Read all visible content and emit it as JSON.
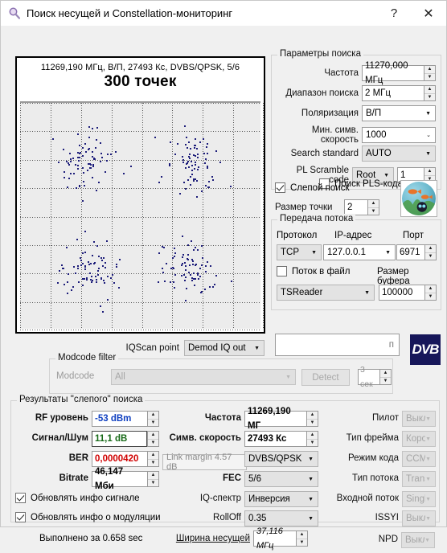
{
  "window": {
    "title": "Поиск несущей и Constellation-мониторинг",
    "icon": "magnifier-icon",
    "help_label": "?",
    "close_label": "✕"
  },
  "constellation": {
    "header_line1": "11269,190 МГц, В/П, 27493 Кс, DVBS/QPSK, 5/6",
    "header_line2": "300 точек",
    "point_color": "#1d1d7a",
    "background": "#ececec",
    "grid_divisions": 8
  },
  "search_params": {
    "legend": "Параметры поиска",
    "frequency": {
      "label": "Частота",
      "value": "11270,000 МГц"
    },
    "range": {
      "label": "Диапазон поиска",
      "value": "2 МГц"
    },
    "polarization": {
      "label": "Поляризация",
      "value": "В/П"
    },
    "min_symbol_rate": {
      "label": "Мин. симв. скорость",
      "value": "1000"
    },
    "search_standard": {
      "label": "Search standard",
      "value": "AUTO"
    },
    "pl_scramble": {
      "label": "PL Scramble code",
      "mode": "Root",
      "value": "1"
    },
    "pls_search": {
      "label": "Поиск PLS-кода",
      "checked": false
    }
  },
  "blind": {
    "blind_search": {
      "label": "Слепой поиск",
      "checked": true
    },
    "point_size": {
      "label": "Размер точки",
      "value": "2"
    },
    "aquarium_icon": "aquarium-thumbnail"
  },
  "stream": {
    "legend": "Передача потока",
    "protocol_label": "Протокол",
    "protocol_value": "TCP",
    "ip_label": "IP-адрес",
    "ip_value": "127.0.0.1",
    "port_label": "Порт",
    "port_value": "6971",
    "to_file": {
      "label": "Поток в файл",
      "checked": false
    },
    "app_value": "TSReader",
    "buffer_label": "Размер буфера",
    "buffer_value": "100000"
  },
  "iqscan": {
    "label": "IQScan point",
    "value": "Demod IQ out",
    "info_value": "п"
  },
  "modcode": {
    "legend": "Modcode filter",
    "label": "Modcode",
    "value": "All",
    "detect_label": "Detect",
    "timeout_value": "3 сек"
  },
  "dvb_logo": "DVB",
  "results": {
    "legend": "Результаты \"слепого\" поиска",
    "rf_level": {
      "label": "RF уровень",
      "value": "-53 dBm",
      "color": "#1040c0"
    },
    "snr": {
      "label": "Сигнал/Шум",
      "value": "11,1 dB",
      "color": "#186a18"
    },
    "ber": {
      "label": "BER",
      "value": "0,0000420",
      "color": "#d00000"
    },
    "bitrate": {
      "label": "Bitrate",
      "value": "46,147 Мби"
    },
    "link_margin": "Link margin 4.57 dB",
    "frequency": {
      "label": "Частота",
      "value": "11269,190 МГ"
    },
    "symbol_rate": {
      "label": "Симв. скорость",
      "value": "27493 Кс"
    },
    "modulation_value": "DVBS/QPSK",
    "fec": {
      "label": "FEC",
      "value": "5/6"
    },
    "iq_spectrum": {
      "label": "IQ-спектр",
      "value": "Инверсия"
    },
    "rolloff": {
      "label": "RollOff",
      "value": "0.35"
    },
    "carrier_width": {
      "label": "Ширина несущей",
      "value": "37,116 МГц"
    },
    "pilot": {
      "label": "Пилот",
      "value": "Выкл."
    },
    "frame_type": {
      "label": "Тип фрейма",
      "value": "Короткий"
    },
    "code_mode": {
      "label": "Режим кода",
      "value": "CCM"
    },
    "stream_type": {
      "label": "Тип потока",
      "value": "Transport"
    },
    "input_stream": {
      "label": "Входной поток",
      "value": "Single"
    },
    "issyi": {
      "label": "ISSYI",
      "value": "Выкл."
    },
    "npd": {
      "label": "NPD",
      "value": "Выкл."
    },
    "update_signal": {
      "label": "Обновлять инфо сигнале",
      "checked": true
    },
    "update_modulation": {
      "label": "Обновлять инфо о модуляции",
      "checked": true
    },
    "elapsed": "Выполнено за 0.658 sec"
  }
}
